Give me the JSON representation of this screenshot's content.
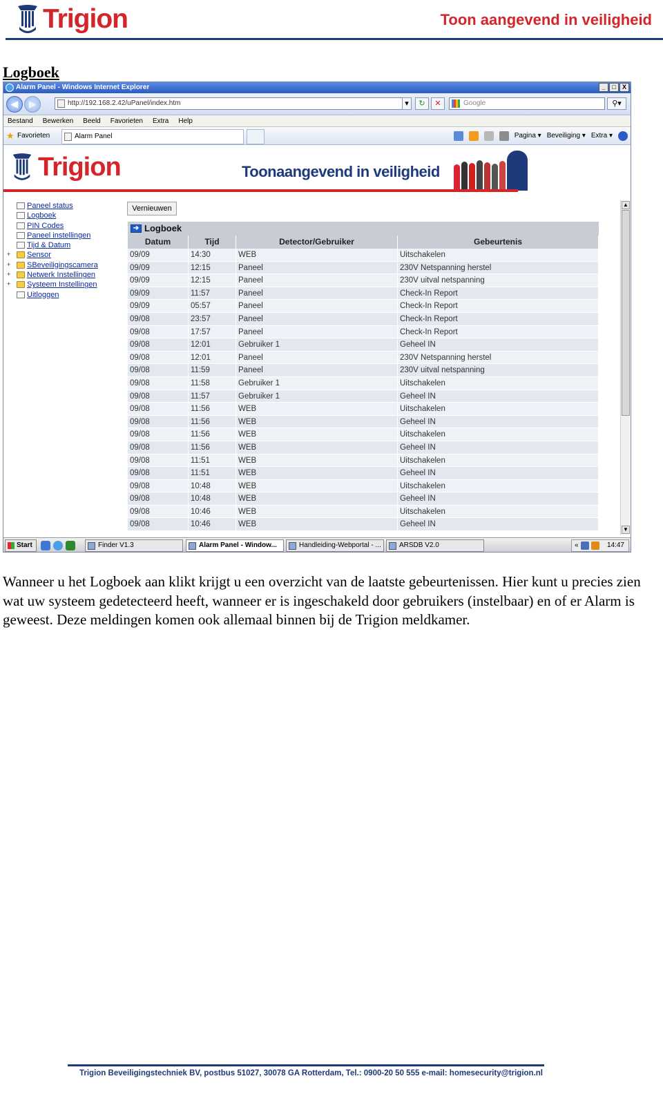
{
  "header": {
    "brand": "Trigion",
    "tagline": "Toon aangevend in veiligheid",
    "accent_color": "#d3252a",
    "navy_color": "#1f3a7a"
  },
  "section_title": "Logboek",
  "browser": {
    "window_title": "Alarm Panel - Windows Internet Explorer",
    "window_buttons": [
      "_",
      "□",
      "X"
    ],
    "url": "http://192.168.2.42/uPanel/index.htm",
    "search_placeholder": "Google",
    "menu": [
      "Bestand",
      "Bewerken",
      "Beeld",
      "Favorieten",
      "Extra",
      "Help"
    ],
    "favorites_label": "Favorieten",
    "tab_label": "Alarm Panel",
    "commands": [
      "Pagina ▾",
      "Beveiliging ▾",
      "Extra ▾"
    ]
  },
  "site": {
    "brand": "Trigion",
    "tagline": "Toonaangevend in veiligheid"
  },
  "tree": [
    {
      "label": "Paneel status",
      "type": "page",
      "expandable": false
    },
    {
      "label": "Logboek",
      "type": "page",
      "expandable": false
    },
    {
      "label": "PIN Codes",
      "type": "page",
      "expandable": false
    },
    {
      "label": "Paneel instellingen",
      "type": "page",
      "expandable": false
    },
    {
      "label": "Tijd & Datum",
      "type": "page",
      "expandable": false
    },
    {
      "label": "Sensor",
      "type": "folder",
      "expandable": true
    },
    {
      "label": "SBeveiligingscamera",
      "type": "folder",
      "expandable": true
    },
    {
      "label": "Netwerk Instellingen",
      "type": "folder",
      "expandable": true
    },
    {
      "label": "Systeem Instellingen",
      "type": "folder",
      "expandable": true
    },
    {
      "label": "Uitloggen",
      "type": "page",
      "expandable": false
    }
  ],
  "refresh_label": "Vernieuwen",
  "log": {
    "title": "Logboek",
    "columns": [
      "Datum",
      "Tijd",
      "Detector/Gebruiker",
      "Gebeurtenis"
    ],
    "rows": [
      [
        "09/09",
        "14:30",
        "WEB",
        "Uitschakelen"
      ],
      [
        "09/09",
        "12:15",
        "Paneel",
        "230V Netspanning herstel"
      ],
      [
        "09/09",
        "12:15",
        "Paneel",
        "230V uitval netspanning"
      ],
      [
        "09/09",
        "11:57",
        "Paneel",
        "Check-In Report"
      ],
      [
        "09/09",
        "05:57",
        "Paneel",
        "Check-In Report"
      ],
      [
        "09/08",
        "23:57",
        "Paneel",
        "Check-In Report"
      ],
      [
        "09/08",
        "17:57",
        "Paneel",
        "Check-In Report"
      ],
      [
        "09/08",
        "12:01",
        "Gebruiker 1",
        "Geheel IN"
      ],
      [
        "09/08",
        "12:01",
        "Paneel",
        "230V Netspanning herstel"
      ],
      [
        "09/08",
        "11:59",
        "Paneel",
        "230V uitval netspanning"
      ],
      [
        "09/08",
        "11:58",
        "Gebruiker 1",
        "Uitschakelen"
      ],
      [
        "09/08",
        "11:57",
        "Gebruiker 1",
        "Geheel IN"
      ],
      [
        "09/08",
        "11:56",
        "WEB",
        "Uitschakelen"
      ],
      [
        "09/08",
        "11:56",
        "WEB",
        "Geheel IN"
      ],
      [
        "09/08",
        "11:56",
        "WEB",
        "Uitschakelen"
      ],
      [
        "09/08",
        "11:56",
        "WEB",
        "Geheel IN"
      ],
      [
        "09/08",
        "11:51",
        "WEB",
        "Uitschakelen"
      ],
      [
        "09/08",
        "11:51",
        "WEB",
        "Geheel IN"
      ],
      [
        "09/08",
        "10:48",
        "WEB",
        "Uitschakelen"
      ],
      [
        "09/08",
        "10:48",
        "WEB",
        "Geheel IN"
      ],
      [
        "09/08",
        "10:46",
        "WEB",
        "Uitschakelen"
      ],
      [
        "09/08",
        "10:46",
        "WEB",
        "Geheel IN"
      ]
    ]
  },
  "taskbar": {
    "start_label": "Start",
    "tasks": [
      {
        "label": "Finder V1.3",
        "active": false
      },
      {
        "label": "Alarm Panel - Window...",
        "active": true
      },
      {
        "label": "Handleiding-Webportal - ...",
        "active": false
      },
      {
        "label": "ARSDB V2.0",
        "active": false
      }
    ],
    "clock": "14:47",
    "tray_chevron": "«"
  },
  "description": "Wanneer u het Logboek aan klikt krijgt u een overzicht van de laatste gebeurtenissen. Hier kunt u precies zien wat uw systeem gedetecteerd heeft, wanneer er is ingeschakeld door gebruikers (instelbaar) en of er Alarm is geweest. Deze meldingen komen ook allemaal binnen bij de Trigion meldkamer.",
  "footer": "Trigion Beveiligingstechniek BV,  postbus 51027,  30078 GA  Rotterdam,  Tel.: 0900-20 50 555 e-mail: homesecurity@trigion.nl"
}
